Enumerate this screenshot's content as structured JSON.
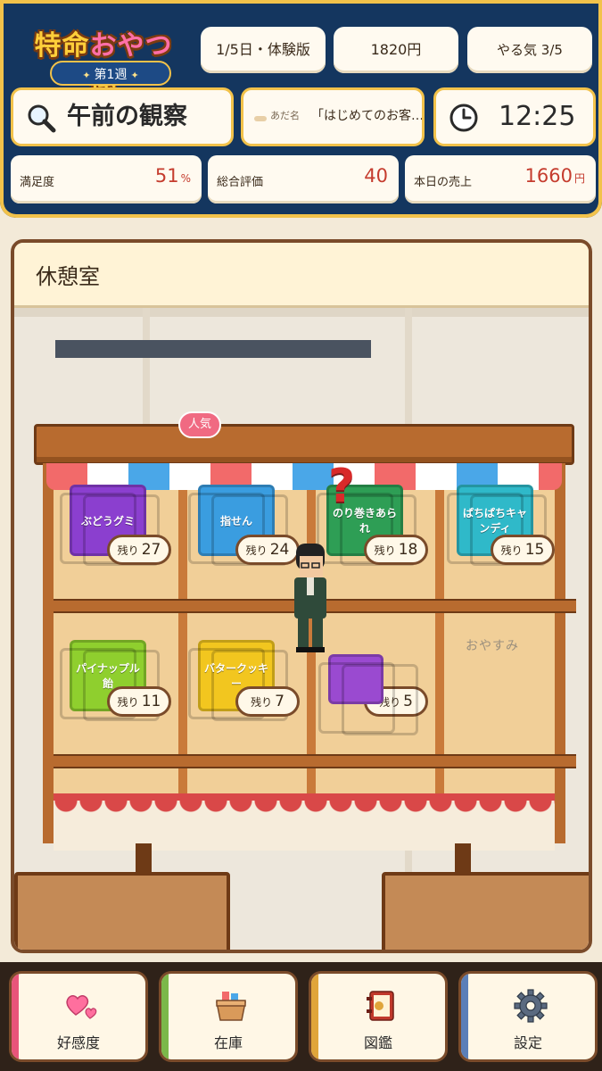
{
  "header": {
    "logo": {
      "title_part1": "特命",
      "title_part2": "おやつ",
      "title_part3": "係",
      "week": "第1週"
    },
    "day": "1/5日・体験版",
    "money": "1820円",
    "motivation": "やる気 3/5",
    "phase": "午前の観察",
    "nickname_label": "あだ名",
    "nickname_value": "「はじめてのお客…",
    "time": "12:25",
    "stats": {
      "satisfaction_label": "満足度",
      "satisfaction_value": "51",
      "satisfaction_unit": "%",
      "rating_label": "総合評価",
      "rating_value": "40",
      "sales_label": "本日の売上",
      "sales_value": "1660",
      "sales_unit": "円"
    }
  },
  "room": {
    "title": "休憩室",
    "stock_prefix": "残り",
    "popular_badge": "人気",
    "closed_label": "おやすみ",
    "products": [
      {
        "name": "ぶどうグミ",
        "color": "#8b3fcf",
        "stock": "27"
      },
      {
        "name": "指せん",
        "color": "#3a9de0",
        "stock": "24"
      },
      {
        "name": "のり巻きあられ",
        "color": "#2e9e55",
        "stock": "18"
      },
      {
        "name": "ぱちぱちキャンディ",
        "color": "#2fb9c9",
        "stock": "15"
      },
      {
        "name": "パイナップル飴",
        "color": "#8fcf2e",
        "stock": "11"
      },
      {
        "name": "バタークッキー",
        "color": "#f2c61f",
        "stock": "7"
      },
      {
        "name": "",
        "color": "#9a4ad0",
        "stock": "5"
      }
    ]
  },
  "nav": {
    "items": [
      {
        "label": "好感度",
        "icon": "hearts-icon",
        "color": "#e8557a"
      },
      {
        "label": "在庫",
        "icon": "box-icon",
        "color": "#7bb84a"
      },
      {
        "label": "図鑑",
        "icon": "book-icon",
        "color": "#e0a53a"
      },
      {
        "label": "設定",
        "icon": "gear-icon",
        "color": "#5a7fb8"
      }
    ]
  }
}
